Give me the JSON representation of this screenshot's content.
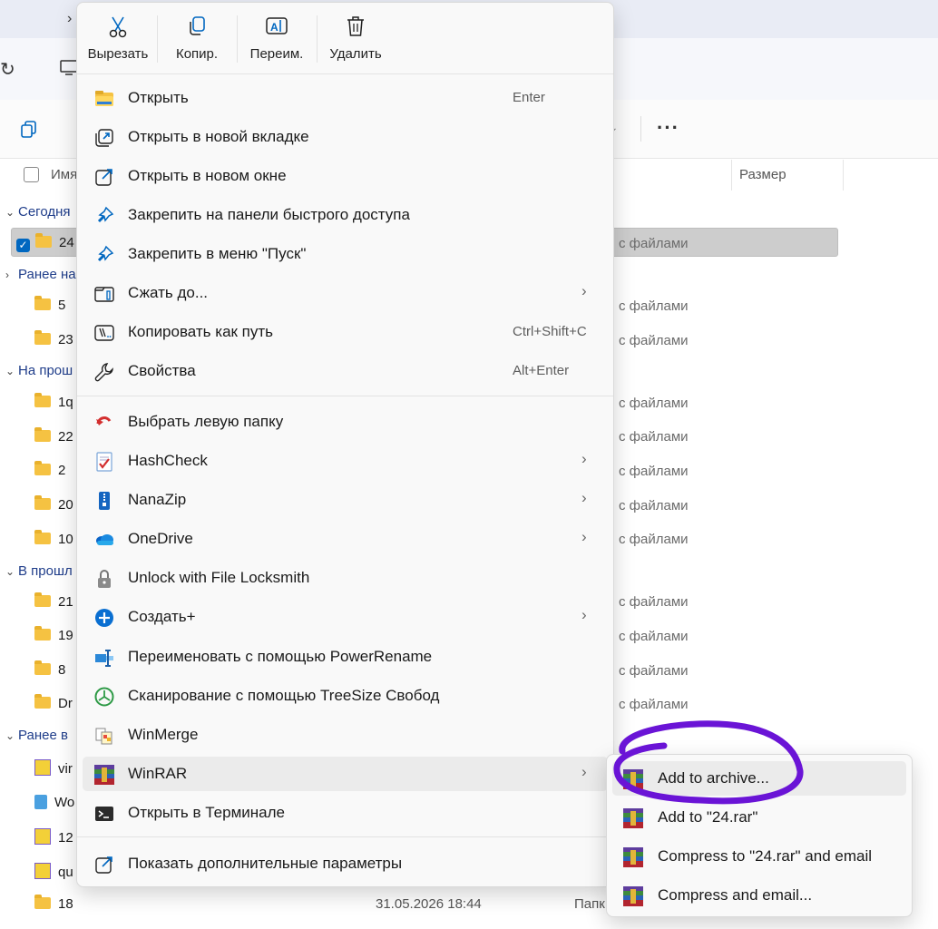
{
  "explorer": {
    "column_name": "Имя",
    "column_size": "Размер",
    "groups": [
      "Сегодня",
      "Ранее на",
      "На прош",
      "В прошл",
      "Ранее в"
    ],
    "files": [
      "24",
      "5",
      "23",
      "1q",
      "22",
      "2",
      "20",
      "10",
      "21",
      "19",
      "8",
      "Dr",
      "vir",
      "Wo",
      "12",
      "qu",
      "18"
    ],
    "file_type": "с файлами",
    "last_date": "31.05.2026 18:44",
    "last_type": "Папк"
  },
  "quick_actions": [
    {
      "label": "Вырезать",
      "icon": "scissors-icon"
    },
    {
      "label": "Копир.",
      "icon": "copy-icon"
    },
    {
      "label": "Переим.",
      "icon": "rename-icon"
    },
    {
      "label": "Удалить",
      "icon": "trash-icon"
    }
  ],
  "menu": {
    "items": [
      {
        "label": "Открыть",
        "shortcut": "Enter",
        "icon": "folder-open-icon"
      },
      {
        "label": "Открыть в новой вкладке",
        "shortcut": "",
        "icon": "new-tab-icon"
      },
      {
        "label": "Открыть в новом окне",
        "shortcut": "",
        "icon": "new-window-icon"
      },
      {
        "label": "Закрепить на панели быстрого доступа",
        "shortcut": "",
        "icon": "pin-icon"
      },
      {
        "label": "Закрепить в меню \"Пуск\"",
        "shortcut": "",
        "icon": "pin-start-icon"
      },
      {
        "label": "Сжать до...",
        "shortcut": "",
        "icon": "zip-icon"
      },
      {
        "label": "Копировать как путь",
        "shortcut": "Ctrl+Shift+C",
        "icon": "copy-path-icon"
      },
      {
        "label": "Свойства",
        "shortcut": "Alt+Enter",
        "icon": "wrench-icon"
      },
      {
        "label": "Выбрать левую папку",
        "shortcut": "",
        "icon": "undo-red-icon"
      },
      {
        "label": "HashCheck",
        "shortcut": "",
        "icon": "hashcheck-icon"
      },
      {
        "label": "NanaZip",
        "shortcut": "",
        "icon": "nanazip-icon"
      },
      {
        "label": "OneDrive",
        "shortcut": "",
        "icon": "onedrive-cloud-icon"
      },
      {
        "label": "Unlock with File Locksmith",
        "shortcut": "",
        "icon": "lock-icon"
      },
      {
        "label": "Создать+",
        "shortcut": "",
        "icon": "plus-circle-icon"
      },
      {
        "label": "Переименовать с помощью PowerRename",
        "shortcut": "",
        "icon": "powerrename-icon"
      },
      {
        "label": "Сканирование с помощью TreeSize Свобод",
        "shortcut": "",
        "icon": "treesize-icon"
      },
      {
        "label": "WinMerge",
        "shortcut": "",
        "icon": "winmerge-icon"
      },
      {
        "label": "WinRAR",
        "shortcut": "",
        "icon": "winrar-icon"
      },
      {
        "label": "Открыть в Терминале",
        "shortcut": "",
        "icon": "terminal-icon"
      },
      {
        "label": "Показать дополнительные параметры",
        "shortcut": "",
        "icon": "more-options-icon"
      }
    ]
  },
  "submenu": {
    "items": [
      {
        "label": "Add to archive...",
        "icon": "winrar-icon"
      },
      {
        "label": "Add to \"24.rar\"",
        "icon": "winrar-icon"
      },
      {
        "label": "Compress to \"24.rar\" and email",
        "icon": "winrar-icon"
      },
      {
        "label": "Compress and email...",
        "icon": "winrar-icon"
      }
    ]
  },
  "colors": {
    "accent": "#0067c0",
    "annotation": "#6a14d6",
    "hover": "#ebebeb"
  }
}
